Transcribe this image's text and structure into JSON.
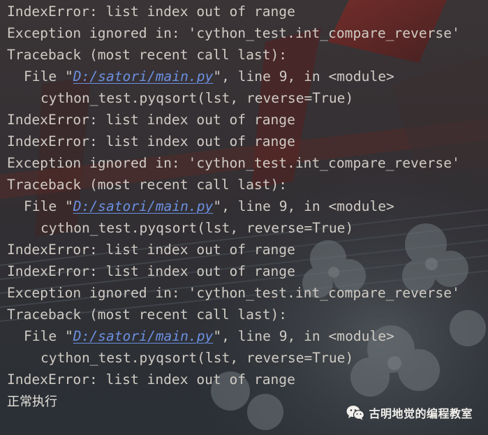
{
  "theme": {
    "text_color": "#d0cbc4",
    "link_color": "#6b8fe0",
    "background": "#2b2f33"
  },
  "console": {
    "lines": [
      {
        "indent": 0,
        "text": "IndexError: list index out of range"
      },
      {
        "indent": 0,
        "text": "Exception ignored in: 'cython_test.int_compare_reverse'"
      },
      {
        "indent": 0,
        "text": "Traceback (most recent call last):"
      },
      {
        "indent": 1,
        "prefix": "File \"",
        "link": "D:/satori/main.py",
        "suffix": "\", line 9, in <module>"
      },
      {
        "indent": 2,
        "text": "cython_test.pyqsort(lst, reverse=True)"
      },
      {
        "indent": 0,
        "text": "IndexError: list index out of range"
      },
      {
        "indent": 0,
        "text": "IndexError: list index out of range"
      },
      {
        "indent": 0,
        "text": "Exception ignored in: 'cython_test.int_compare_reverse'"
      },
      {
        "indent": 0,
        "text": "Traceback (most recent call last):"
      },
      {
        "indent": 1,
        "prefix": "File \"",
        "link": "D:/satori/main.py",
        "suffix": "\", line 9, in <module>"
      },
      {
        "indent": 2,
        "text": "cython_test.pyqsort(lst, reverse=True)"
      },
      {
        "indent": 0,
        "text": "IndexError: list index out of range"
      },
      {
        "indent": 0,
        "text": "IndexError: list index out of range"
      },
      {
        "indent": 0,
        "text": "Exception ignored in: 'cython_test.int_compare_reverse'"
      },
      {
        "indent": 0,
        "text": "Traceback (most recent call last):"
      },
      {
        "indent": 1,
        "prefix": "File \"",
        "link": "D:/satori/main.py",
        "suffix": "\", line 9, in <module>"
      },
      {
        "indent": 2,
        "text": "cython_test.pyqsort(lst, reverse=True)"
      },
      {
        "indent": 0,
        "text": "IndexError: list index out of range"
      }
    ],
    "status_text": "正常执行"
  },
  "watermark": {
    "icon": "wechat-icon",
    "text": "古明地觉的编程教室"
  }
}
